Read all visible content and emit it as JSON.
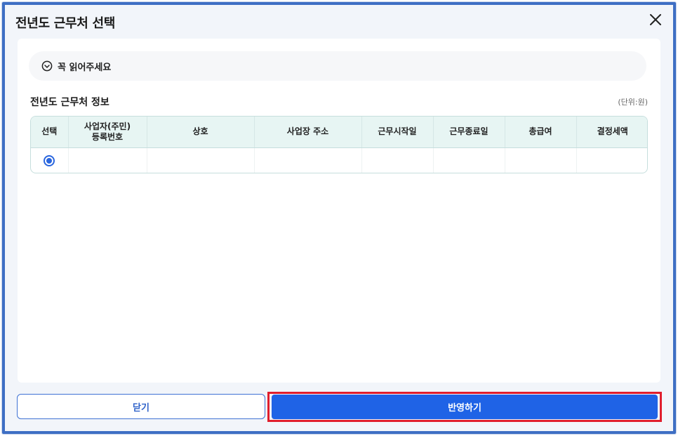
{
  "dialog": {
    "title": "전년도 근무처 선택"
  },
  "notice": {
    "label": "꼭 읽어주세요"
  },
  "section": {
    "title": "전년도 근무처 정보",
    "unit": "(단위:원)"
  },
  "table": {
    "headers": {
      "select": "선택",
      "reg_no_line1": "사업자(주민)",
      "reg_no_line2": "등록번호",
      "company": "상호",
      "address": "사업장 주소",
      "start_date": "근무시작일",
      "end_date": "근무종료일",
      "total_pay": "총급여",
      "final_tax": "결정세액"
    },
    "rows": [
      {
        "selected": true,
        "reg_no": "",
        "company": "",
        "address": "",
        "start_date": "",
        "end_date": "",
        "total_pay": "",
        "final_tax": ""
      }
    ]
  },
  "footer": {
    "close_label": "닫기",
    "apply_label": "반영하기"
  },
  "colors": {
    "frame_border": "#3e6fc4",
    "primary": "#1f63e6",
    "highlight": "#e01e2d",
    "table_header_bg": "#e7f5f3"
  },
  "icons": {
    "close": "close-icon",
    "notice": "chevron-down-circle-icon"
  }
}
